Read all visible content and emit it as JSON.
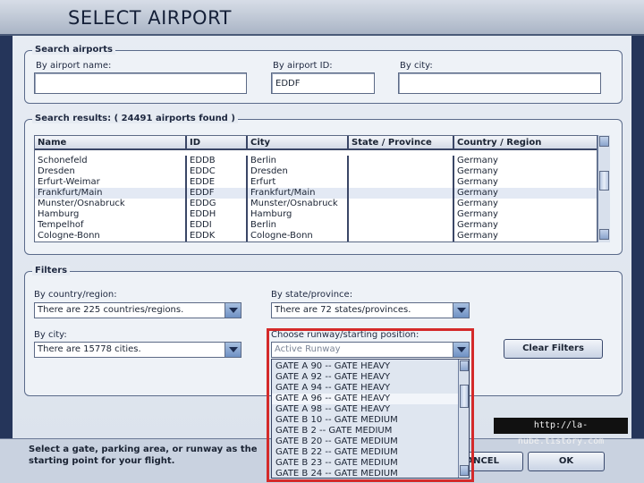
{
  "window": {
    "title": "SELECT AIRPORT"
  },
  "search": {
    "group_label": "Search airports",
    "name_label": "By airport name:",
    "name_value": "",
    "id_label": "By airport ID:",
    "id_value": "EDDF",
    "city_label": "By city:",
    "city_value": ""
  },
  "results": {
    "group_label": "Search results: ( 24491 airports found )",
    "columns": [
      "Name",
      "ID",
      "City",
      "State / Province",
      "Country / Region"
    ],
    "rows": [
      [
        "Schonefeld",
        "EDDB",
        "Berlin",
        "",
        "Germany"
      ],
      [
        "Dresden",
        "EDDC",
        "Dresden",
        "",
        "Germany"
      ],
      [
        "Erfurt-Weimar",
        "EDDE",
        "Erfurt",
        "",
        "Germany"
      ],
      [
        "Frankfurt/Main",
        "EDDF",
        "Frankfurt/Main",
        "",
        "Germany"
      ],
      [
        "Munster/Osnabruck",
        "EDDG",
        "Munster/Osnabruck",
        "",
        "Germany"
      ],
      [
        "Hamburg",
        "EDDH",
        "Hamburg",
        "",
        "Germany"
      ],
      [
        "Tempelhof",
        "EDDI",
        "Berlin",
        "",
        "Germany"
      ],
      [
        "Cologne-Bonn",
        "EDDK",
        "Cologne-Bonn",
        "",
        "Germany"
      ]
    ]
  },
  "filters": {
    "group_label": "Filters",
    "country_label": "By country/region:",
    "country_value": "There are 225 countries/regions.",
    "state_label": "By state/province:",
    "state_value": "There are 72 states/provinces.",
    "city_label": "By city:",
    "city_value": "There are 15778 cities.",
    "runway_label": "Choose runway/starting position:",
    "runway_value": "Active Runway",
    "clear_button": "Clear Filters",
    "runway_options": [
      "GATE A 90 -- GATE HEAVY",
      "GATE A 92 -- GATE HEAVY",
      "GATE A 94 -- GATE HEAVY",
      "GATE A 96 -- GATE HEAVY",
      "GATE A 98 -- GATE HEAVY",
      "GATE B 10 -- GATE MEDIUM",
      "GATE B 2 -- GATE MEDIUM",
      "GATE B 20 -- GATE MEDIUM",
      "GATE B 22 -- GATE MEDIUM",
      "GATE B 23 -- GATE MEDIUM",
      "GATE B 24 -- GATE MEDIUM"
    ]
  },
  "footer": {
    "help_text": "Select a gate, parking area, or runway as the starting point for your flight.",
    "cancel_button": "CANCEL",
    "ok_button": "OK"
  },
  "watermark": {
    "text": "http://la-nube.tistory.com"
  },
  "colors": {
    "highlight_border": "#d42a2a",
    "accent": "#25355a",
    "selected_row": "#e3e9f4"
  }
}
